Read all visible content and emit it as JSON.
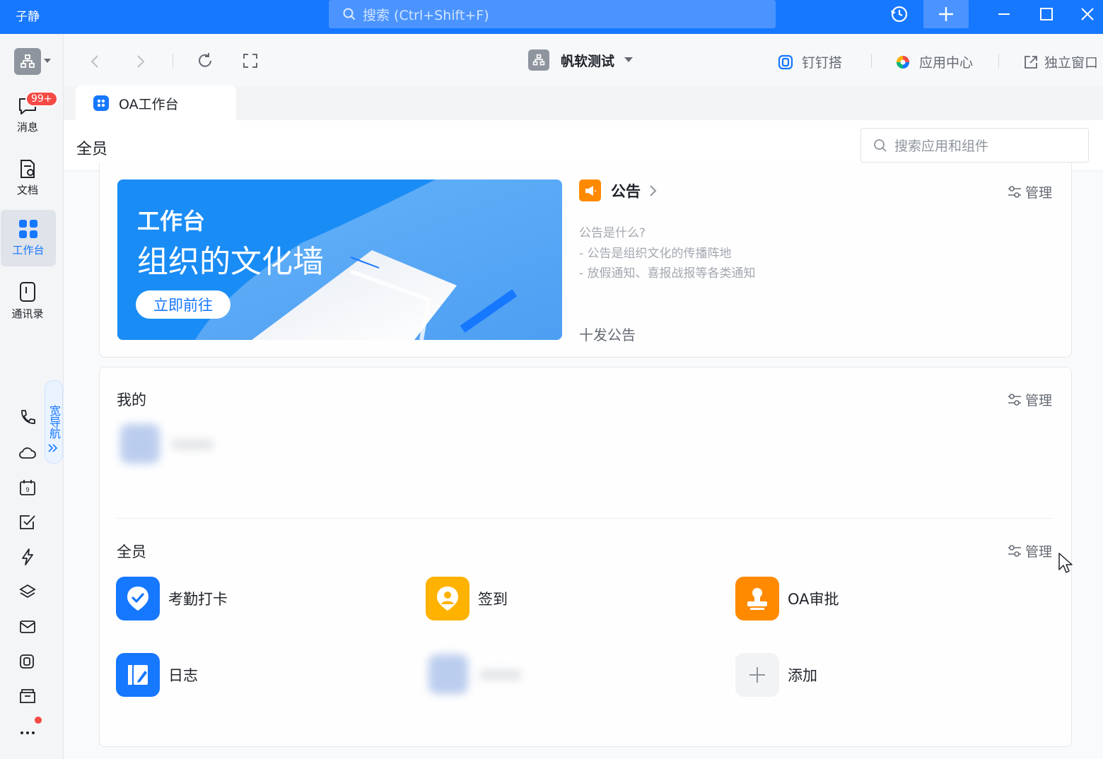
{
  "titlebar": {
    "user_name": "子静",
    "search_placeholder": "搜索 (Ctrl+Shift+F)"
  },
  "rail": {
    "items": [
      {
        "label": "消息",
        "badge": "99+"
      },
      {
        "label": "文档"
      },
      {
        "label": "工作台"
      },
      {
        "label": "通讯录"
      }
    ],
    "wide_nav_label": "宽导航"
  },
  "toolbar": {
    "org_name": "帆软测试",
    "dingtalk_builder": "钉钉搭",
    "app_center": "应用中心",
    "standalone_window": "独立窗口"
  },
  "tab": {
    "label": "OA工作台"
  },
  "page": {
    "scope_title": "全员",
    "app_search_placeholder": "搜索应用和组件"
  },
  "banner": {
    "line1": "工作台",
    "line2": "组织的文化墙",
    "button": "立即前往"
  },
  "announcement": {
    "title": "公告",
    "manage": "管理",
    "intro_q": "公告是什么?",
    "intro_1": "- 公告是组织文化的传播阵地",
    "intro_2": "- 放假通知、喜报战报等各类通知",
    "publish": "十发公告"
  },
  "mine": {
    "title": "我的",
    "manage": "管理"
  },
  "all_members": {
    "title": "全员",
    "manage": "管理",
    "apps": [
      {
        "label": "考勤打卡",
        "color": "#1677ff"
      },
      {
        "label": "签到",
        "color": "#ffb200"
      },
      {
        "label": "OA审批",
        "color": "#ff8a00"
      },
      {
        "label": "日志",
        "color": "#1677ff"
      },
      {
        "label": "添加",
        "color": "#f2f3f5"
      }
    ]
  },
  "colors": {
    "brand": "#1677ff",
    "badge": "#f54a45"
  }
}
